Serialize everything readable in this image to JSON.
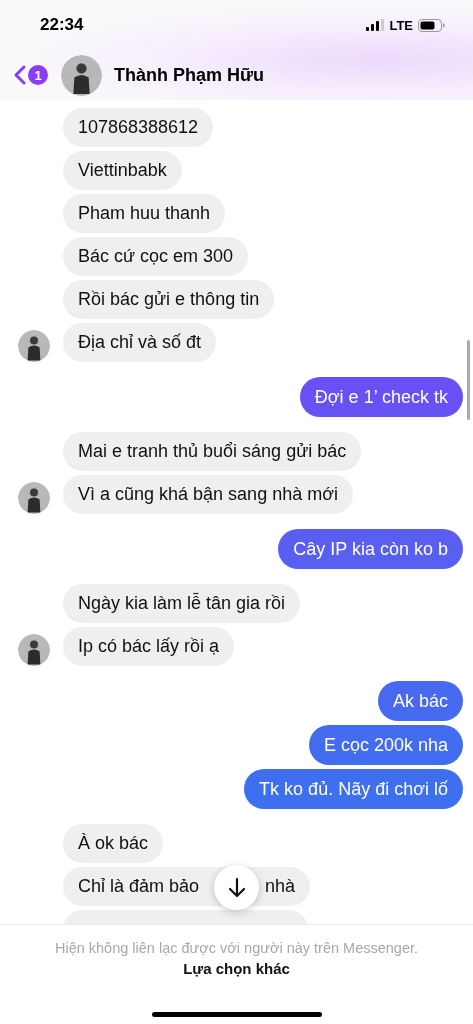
{
  "status_bar": {
    "time": "22:34",
    "network": "LTE"
  },
  "header": {
    "back_badge": "1",
    "contact_name": "Thành Phạm Hữu"
  },
  "messages": [
    {
      "kind": "incoming",
      "text": "107868388612",
      "avatar": false
    },
    {
      "kind": "incoming",
      "text": "Viettinbabk",
      "avatar": false
    },
    {
      "kind": "incoming",
      "text": "Pham huu thanh",
      "avatar": false
    },
    {
      "kind": "incoming",
      "text": "Bác cứ cọc em 300",
      "avatar": false
    },
    {
      "kind": "incoming",
      "text": "Rồi bác gửi e thông tin",
      "avatar": false
    },
    {
      "kind": "incoming",
      "text": "Địa chỉ và số đt",
      "avatar": true
    },
    {
      "kind": "outgoing",
      "text": "Đợi e 1’ check tk"
    },
    {
      "kind": "incoming",
      "text": "Mai e tranh thủ buổi sáng gửi bác",
      "avatar": false
    },
    {
      "kind": "incoming",
      "text": "Vì a cũng khá bận sang nhà mới",
      "avatar": true
    },
    {
      "kind": "outgoing",
      "text": "Cây IP kia còn ko b"
    },
    {
      "kind": "incoming",
      "text": "Ngày kia làm lễ tân gia rồi",
      "avatar": false
    },
    {
      "kind": "incoming",
      "text": "Ip có bác lấy rồi ạ",
      "avatar": true
    },
    {
      "kind": "outgoing",
      "text": "Ak bác"
    },
    {
      "kind": "outgoing",
      "text": "E cọc 200k nha"
    },
    {
      "kind": "outgoing",
      "text": "Tk ko đủ. Nãy đi chơi lố"
    },
    {
      "kind": "incoming",
      "text": "À ok bác",
      "avatar": false
    },
    {
      "kind": "incoming",
      "text": "Chỉ là đảm bảo",
      "text_after": "nhà",
      "avatar": false
    },
    {
      "kind": "incoming",
      "avatar": false
    }
  ],
  "footer": {
    "notice": "Hiện không liên lạc được với người này trên Messenger.",
    "action": "Lựa chọn khác"
  }
}
